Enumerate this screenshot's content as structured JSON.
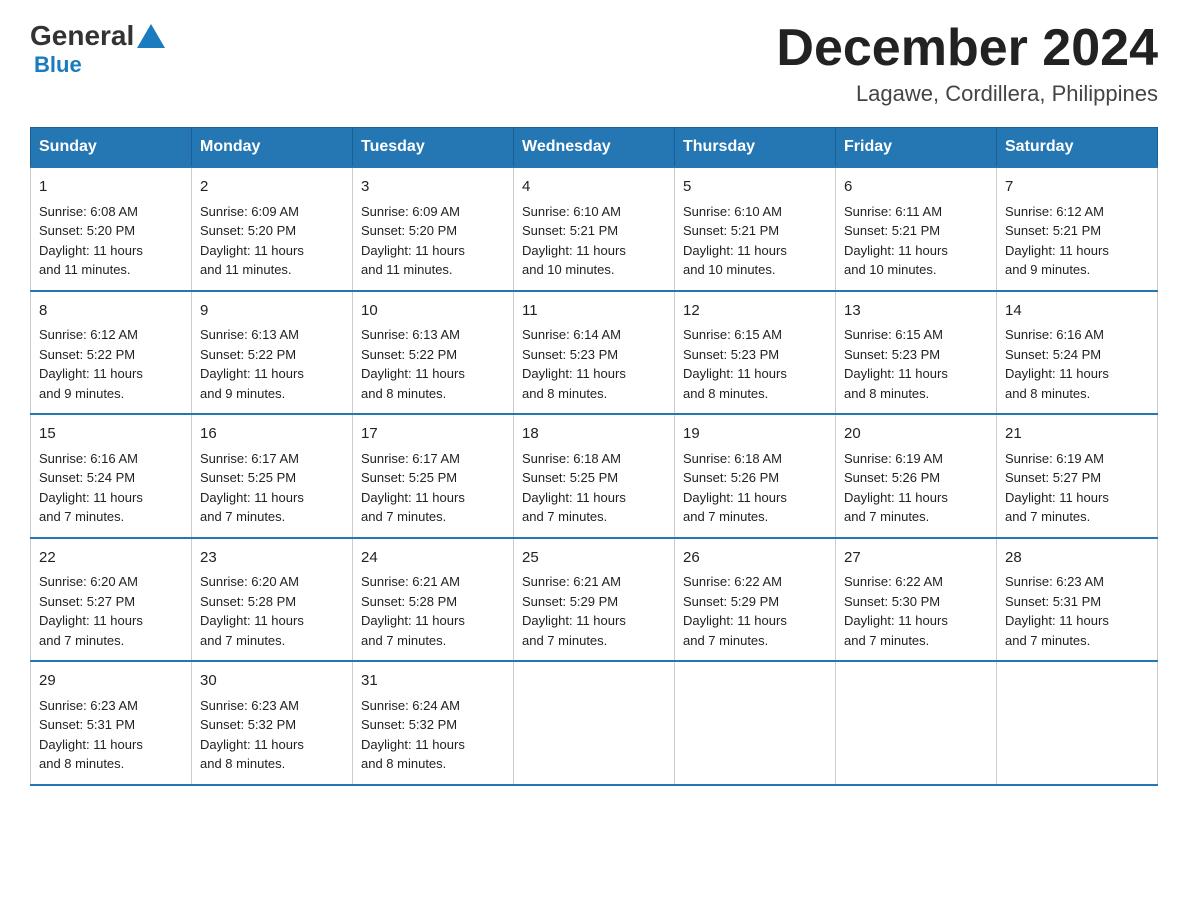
{
  "header": {
    "logo_general": "General",
    "logo_blue": "Blue",
    "month_title": "December 2024",
    "location": "Lagawe, Cordillera, Philippines"
  },
  "days_of_week": [
    "Sunday",
    "Monday",
    "Tuesday",
    "Wednesday",
    "Thursday",
    "Friday",
    "Saturday"
  ],
  "weeks": [
    [
      {
        "day": "1",
        "sunrise": "6:08 AM",
        "sunset": "5:20 PM",
        "daylight": "11 hours and 11 minutes."
      },
      {
        "day": "2",
        "sunrise": "6:09 AM",
        "sunset": "5:20 PM",
        "daylight": "11 hours and 11 minutes."
      },
      {
        "day": "3",
        "sunrise": "6:09 AM",
        "sunset": "5:20 PM",
        "daylight": "11 hours and 11 minutes."
      },
      {
        "day": "4",
        "sunrise": "6:10 AM",
        "sunset": "5:21 PM",
        "daylight": "11 hours and 10 minutes."
      },
      {
        "day": "5",
        "sunrise": "6:10 AM",
        "sunset": "5:21 PM",
        "daylight": "11 hours and 10 minutes."
      },
      {
        "day": "6",
        "sunrise": "6:11 AM",
        "sunset": "5:21 PM",
        "daylight": "11 hours and 10 minutes."
      },
      {
        "day": "7",
        "sunrise": "6:12 AM",
        "sunset": "5:21 PM",
        "daylight": "11 hours and 9 minutes."
      }
    ],
    [
      {
        "day": "8",
        "sunrise": "6:12 AM",
        "sunset": "5:22 PM",
        "daylight": "11 hours and 9 minutes."
      },
      {
        "day": "9",
        "sunrise": "6:13 AM",
        "sunset": "5:22 PM",
        "daylight": "11 hours and 9 minutes."
      },
      {
        "day": "10",
        "sunrise": "6:13 AM",
        "sunset": "5:22 PM",
        "daylight": "11 hours and 8 minutes."
      },
      {
        "day": "11",
        "sunrise": "6:14 AM",
        "sunset": "5:23 PM",
        "daylight": "11 hours and 8 minutes."
      },
      {
        "day": "12",
        "sunrise": "6:15 AM",
        "sunset": "5:23 PM",
        "daylight": "11 hours and 8 minutes."
      },
      {
        "day": "13",
        "sunrise": "6:15 AM",
        "sunset": "5:23 PM",
        "daylight": "11 hours and 8 minutes."
      },
      {
        "day": "14",
        "sunrise": "6:16 AM",
        "sunset": "5:24 PM",
        "daylight": "11 hours and 8 minutes."
      }
    ],
    [
      {
        "day": "15",
        "sunrise": "6:16 AM",
        "sunset": "5:24 PM",
        "daylight": "11 hours and 7 minutes."
      },
      {
        "day": "16",
        "sunrise": "6:17 AM",
        "sunset": "5:25 PM",
        "daylight": "11 hours and 7 minutes."
      },
      {
        "day": "17",
        "sunrise": "6:17 AM",
        "sunset": "5:25 PM",
        "daylight": "11 hours and 7 minutes."
      },
      {
        "day": "18",
        "sunrise": "6:18 AM",
        "sunset": "5:25 PM",
        "daylight": "11 hours and 7 minutes."
      },
      {
        "day": "19",
        "sunrise": "6:18 AM",
        "sunset": "5:26 PM",
        "daylight": "11 hours and 7 minutes."
      },
      {
        "day": "20",
        "sunrise": "6:19 AM",
        "sunset": "5:26 PM",
        "daylight": "11 hours and 7 minutes."
      },
      {
        "day": "21",
        "sunrise": "6:19 AM",
        "sunset": "5:27 PM",
        "daylight": "11 hours and 7 minutes."
      }
    ],
    [
      {
        "day": "22",
        "sunrise": "6:20 AM",
        "sunset": "5:27 PM",
        "daylight": "11 hours and 7 minutes."
      },
      {
        "day": "23",
        "sunrise": "6:20 AM",
        "sunset": "5:28 PM",
        "daylight": "11 hours and 7 minutes."
      },
      {
        "day": "24",
        "sunrise": "6:21 AM",
        "sunset": "5:28 PM",
        "daylight": "11 hours and 7 minutes."
      },
      {
        "day": "25",
        "sunrise": "6:21 AM",
        "sunset": "5:29 PM",
        "daylight": "11 hours and 7 minutes."
      },
      {
        "day": "26",
        "sunrise": "6:22 AM",
        "sunset": "5:29 PM",
        "daylight": "11 hours and 7 minutes."
      },
      {
        "day": "27",
        "sunrise": "6:22 AM",
        "sunset": "5:30 PM",
        "daylight": "11 hours and 7 minutes."
      },
      {
        "day": "28",
        "sunrise": "6:23 AM",
        "sunset": "5:31 PM",
        "daylight": "11 hours and 7 minutes."
      }
    ],
    [
      {
        "day": "29",
        "sunrise": "6:23 AM",
        "sunset": "5:31 PM",
        "daylight": "11 hours and 8 minutes."
      },
      {
        "day": "30",
        "sunrise": "6:23 AM",
        "sunset": "5:32 PM",
        "daylight": "11 hours and 8 minutes."
      },
      {
        "day": "31",
        "sunrise": "6:24 AM",
        "sunset": "5:32 PM",
        "daylight": "11 hours and 8 minutes."
      },
      null,
      null,
      null,
      null
    ]
  ],
  "labels": {
    "sunrise": "Sunrise:",
    "sunset": "Sunset:",
    "daylight": "Daylight:"
  }
}
